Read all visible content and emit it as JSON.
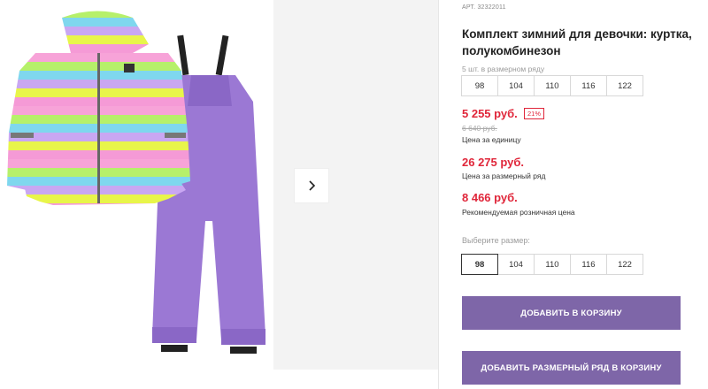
{
  "article": {
    "label": "АРТ.",
    "value": "32322011"
  },
  "product": {
    "title": "Комплект зимний для девочки: куртка, полукомбинезон"
  },
  "size_row": {
    "label": "5 шт. в размерном ряду",
    "sizes": [
      "98",
      "104",
      "110",
      "116",
      "122"
    ]
  },
  "prices": {
    "unit_price": "5 255 руб.",
    "discount": "21%",
    "old_price": "6 640 руб.",
    "unit_caption": "Цена за единицу",
    "row_price": "26 275 руб.",
    "row_caption": "Цена за размерный ряд",
    "retail_price": "8 466 руб.",
    "retail_caption": "Рекомендуемая розничная цена"
  },
  "size_select": {
    "label": "Выберите размер:",
    "options": [
      "98",
      "104",
      "110",
      "116",
      "122"
    ],
    "selected": "98"
  },
  "buttons": {
    "add_to_cart": "ДОБАВИТЬ В КОРЗИНУ",
    "add_row_to_cart": "ДОБАВИТЬ РАЗМЕРНЫЙ РЯД В КОРЗИНУ"
  },
  "colors": {
    "accent_button": "#7e66a8",
    "price_red": "#e0263a"
  },
  "icons": {
    "next": "chevron-right-icon"
  }
}
